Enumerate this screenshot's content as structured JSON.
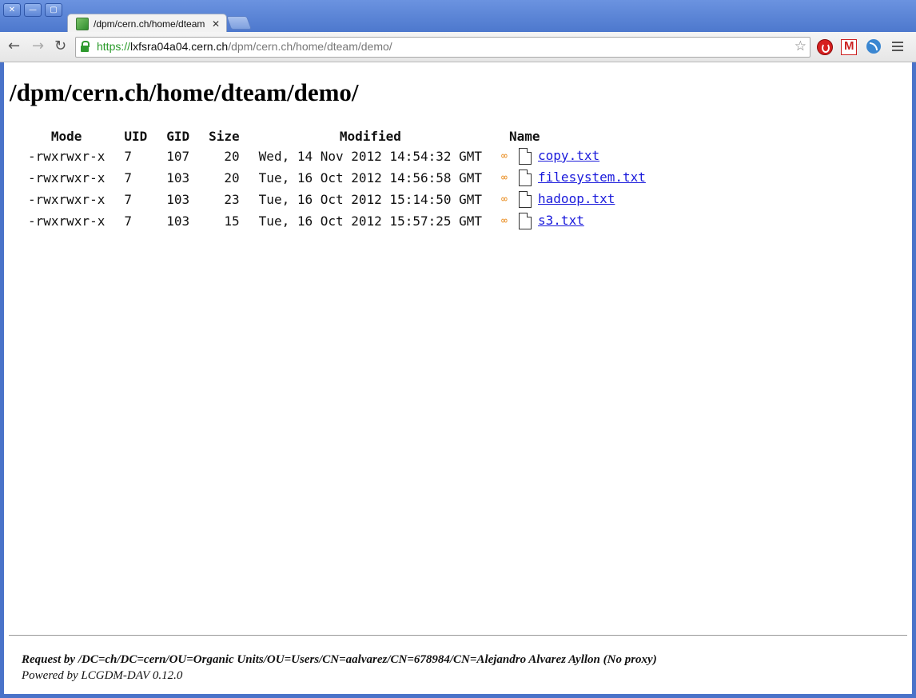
{
  "window": {
    "controls": [
      "✕",
      "—",
      "▢"
    ]
  },
  "tab": {
    "title": "/dpm/cern.ch/home/dteam",
    "close": "✕"
  },
  "address": {
    "scheme": "https://",
    "host": "lxfsra04a04.cern.ch",
    "path": "/dpm/cern.ch/home/dteam/demo/"
  },
  "page": {
    "heading": "/dpm/cern.ch/home/dteam/demo/",
    "columns": [
      "Mode",
      "UID",
      "GID",
      "Size",
      "Modified",
      "Name"
    ],
    "rows": [
      {
        "mode": "-rwxrwxr-x",
        "uid": "7",
        "gid": "107",
        "size": "20",
        "modified": "Wed, 14 Nov 2012 14:54:32 GMT",
        "name": "copy.txt"
      },
      {
        "mode": "-rwxrwxr-x",
        "uid": "7",
        "gid": "103",
        "size": "20",
        "modified": "Tue, 16 Oct 2012 14:56:58 GMT",
        "name": "filesystem.txt"
      },
      {
        "mode": "-rwxrwxr-x",
        "uid": "7",
        "gid": "103",
        "size": "23",
        "modified": "Tue, 16 Oct 2012 15:14:50 GMT",
        "name": "hadoop.txt"
      },
      {
        "mode": "-rwxrwxr-x",
        "uid": "7",
        "gid": "103",
        "size": "15",
        "modified": "Tue, 16 Oct 2012 15:57:25 GMT",
        "name": "s3.txt"
      }
    ],
    "footer_request": "Request by /DC=ch/DC=cern/OU=Organic Units/OU=Users/CN=aalvarez/CN=678984/CN=Alejandro Alvarez Ayllon (No proxy)",
    "footer_powered": "Powered by LCGDM-DAV 0.12.0"
  }
}
